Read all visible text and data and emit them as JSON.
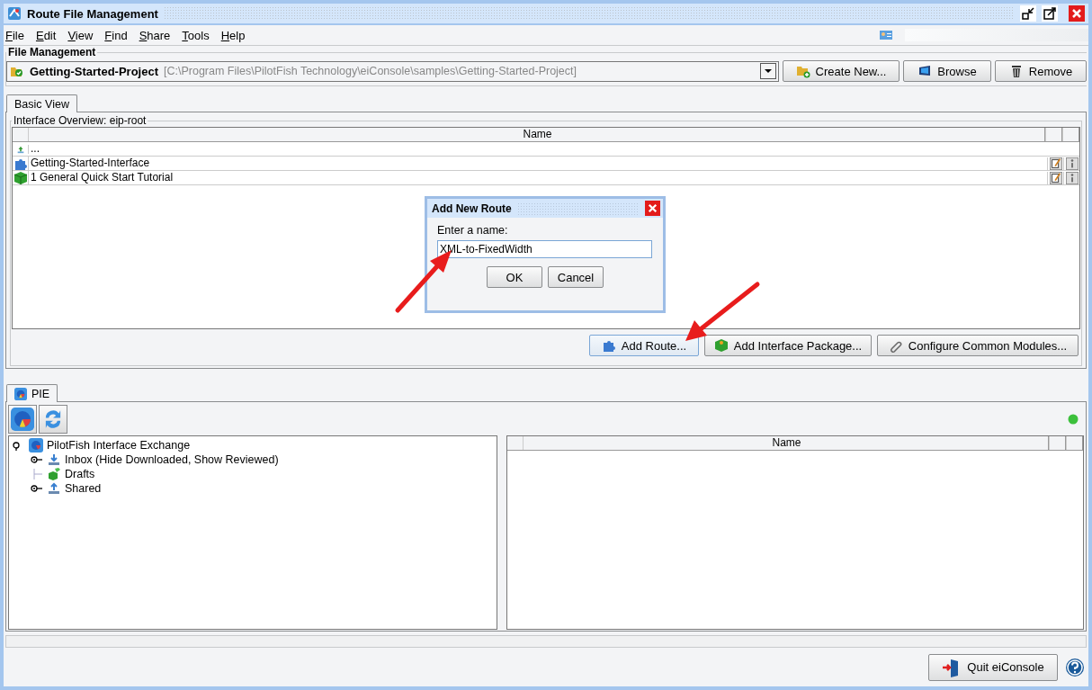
{
  "window": {
    "title": "Route File Management"
  },
  "menu": [
    "File",
    "Edit",
    "View",
    "Find",
    "Share",
    "Tools",
    "Help"
  ],
  "file_management": {
    "title": "File Management",
    "project": {
      "name": "Getting-Started-Project",
      "path": "[C:\\Program Files\\PilotFish Technology\\eiConsole\\samples\\Getting-Started-Project]"
    },
    "buttons": [
      {
        "kind": "create",
        "label": "Create New..."
      },
      {
        "kind": "browse",
        "label": "Browse"
      },
      {
        "kind": "remove",
        "label": "Remove"
      }
    ]
  },
  "tabs": [
    {
      "label": "Basic View",
      "selected": true
    }
  ],
  "interface_overview": {
    "title": "Interface Overview: eip-root",
    "columns": [
      "Name"
    ],
    "rows": [
      {
        "kind": "parent",
        "name": "..."
      },
      {
        "kind": "interface",
        "name": "Getting-Started-Interface"
      },
      {
        "kind": "package",
        "name": "1 General Quick Start Tutorial"
      }
    ],
    "buttons": [
      {
        "kind": "route",
        "label": "Add Route..."
      },
      {
        "kind": "package",
        "label": "Add Interface Package..."
      },
      {
        "kind": "modules",
        "label": "Configure Common Modules..."
      }
    ]
  },
  "dialog": {
    "title": "Add New Route",
    "label": "Enter a name:",
    "value": "XML-to-FixedWidth",
    "buttons": [
      "OK",
      "Cancel"
    ]
  },
  "pie_tabs": [
    {
      "label": "PIE",
      "selected": true
    }
  ],
  "tree": [
    {
      "label": "PilotFish Interface Exchange",
      "kind": "exchange",
      "expanded": true,
      "children": [
        {
          "label": "Inbox (Hide Downloaded, Show Reviewed)",
          "kind": "inbox",
          "expanded": false
        },
        {
          "label": "Drafts",
          "kind": "drafts"
        },
        {
          "label": "Shared",
          "kind": "shared",
          "expanded": false
        }
      ]
    }
  ],
  "pie_table": {
    "columns": [
      "Name"
    ]
  },
  "quit_button": "Quit eiConsole"
}
